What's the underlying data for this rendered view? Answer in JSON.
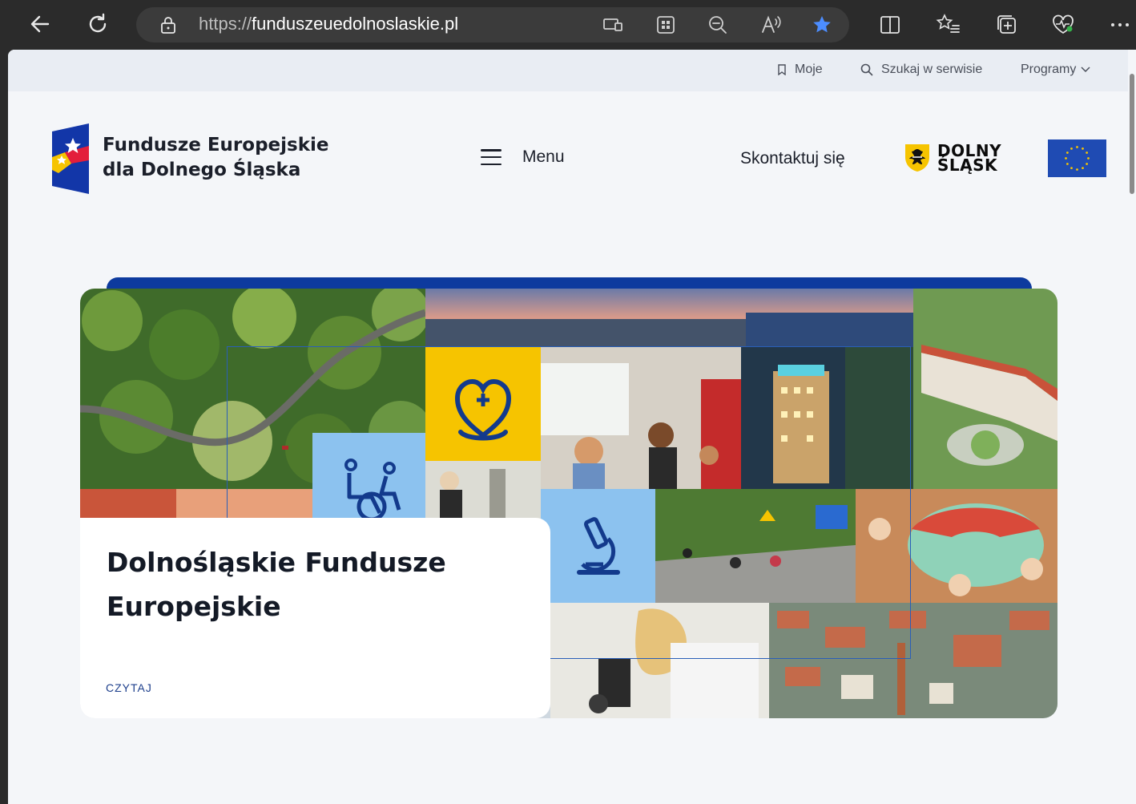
{
  "browser": {
    "url_scheme": "https://",
    "url_host": "funduszeuedolnoslaskie.pl"
  },
  "utility_bar": {
    "saved": "Moje",
    "search": "Szukaj w serwisie",
    "programs": "Programy"
  },
  "header": {
    "logo_line1": "Fundusze Europejskie",
    "logo_line2": "dla Dolnego Śląska",
    "menu_label": "Menu",
    "contact_label": "Skontaktuj się",
    "region_logo_line1": "DOLNY",
    "region_logo_line2": "ŚLĄSK"
  },
  "hero": {
    "title": "Dolnośląskie Fundusze Europejskie",
    "read_link": "CZYTAJ"
  },
  "colors": {
    "brand_blue": "#0d3a9e",
    "brand_yellow": "#f6c400",
    "tile_light_blue": "#8cc2ef"
  },
  "icons": [
    "back-arrow-icon",
    "refresh-icon",
    "lock-icon",
    "bookmark-icon",
    "search-icon",
    "chevron-down-icon",
    "hamburger-icon",
    "heart-health-icon",
    "wheelchair-icon",
    "microscope-icon"
  ]
}
